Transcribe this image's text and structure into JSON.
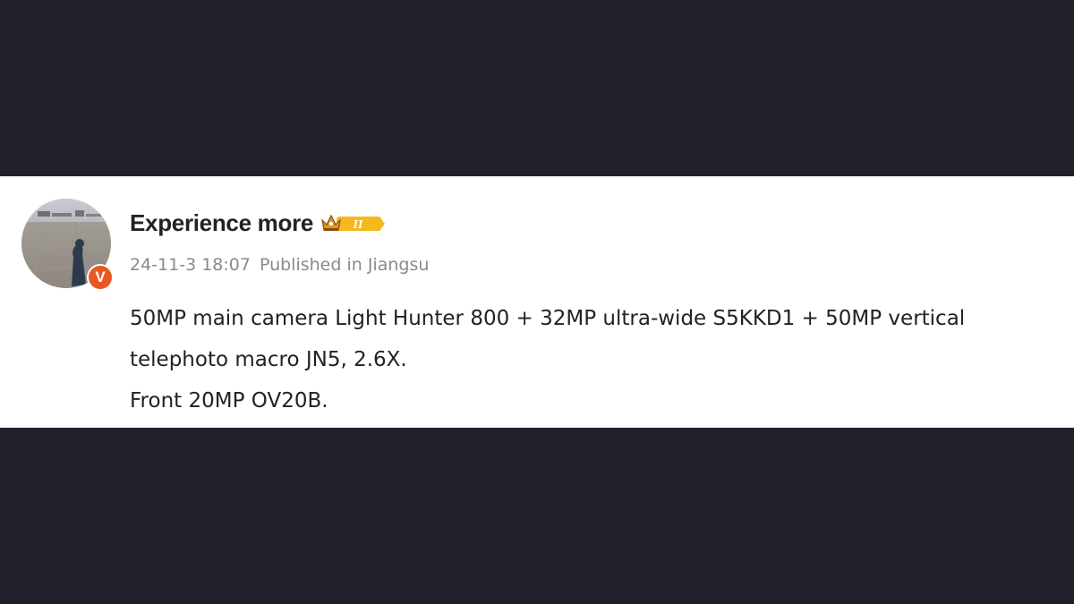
{
  "post": {
    "username": "Experience more",
    "vip_level": "II",
    "verified_mark": "V",
    "timestamp": "24-11-3 18:07",
    "location": "Published in Jiangsu",
    "lines": [
      "50MP main camera Light Hunter 800 + 32MP ultra-wide S5KKD1 + 50MP vertical",
      "telephoto macro JN5, 2.6X.",
      "Front 20MP OV20B."
    ]
  },
  "icons": {
    "avatar": "avatar-photo",
    "verified": "verified-v-icon",
    "vip": "crown-vip-icon"
  },
  "colors": {
    "background_band": "#20202a",
    "card": "#ffffff",
    "verified": "#e8571f",
    "vip_gold": "#f5b91e",
    "meta_text": "#8a8a8a",
    "body_text": "#222222"
  }
}
